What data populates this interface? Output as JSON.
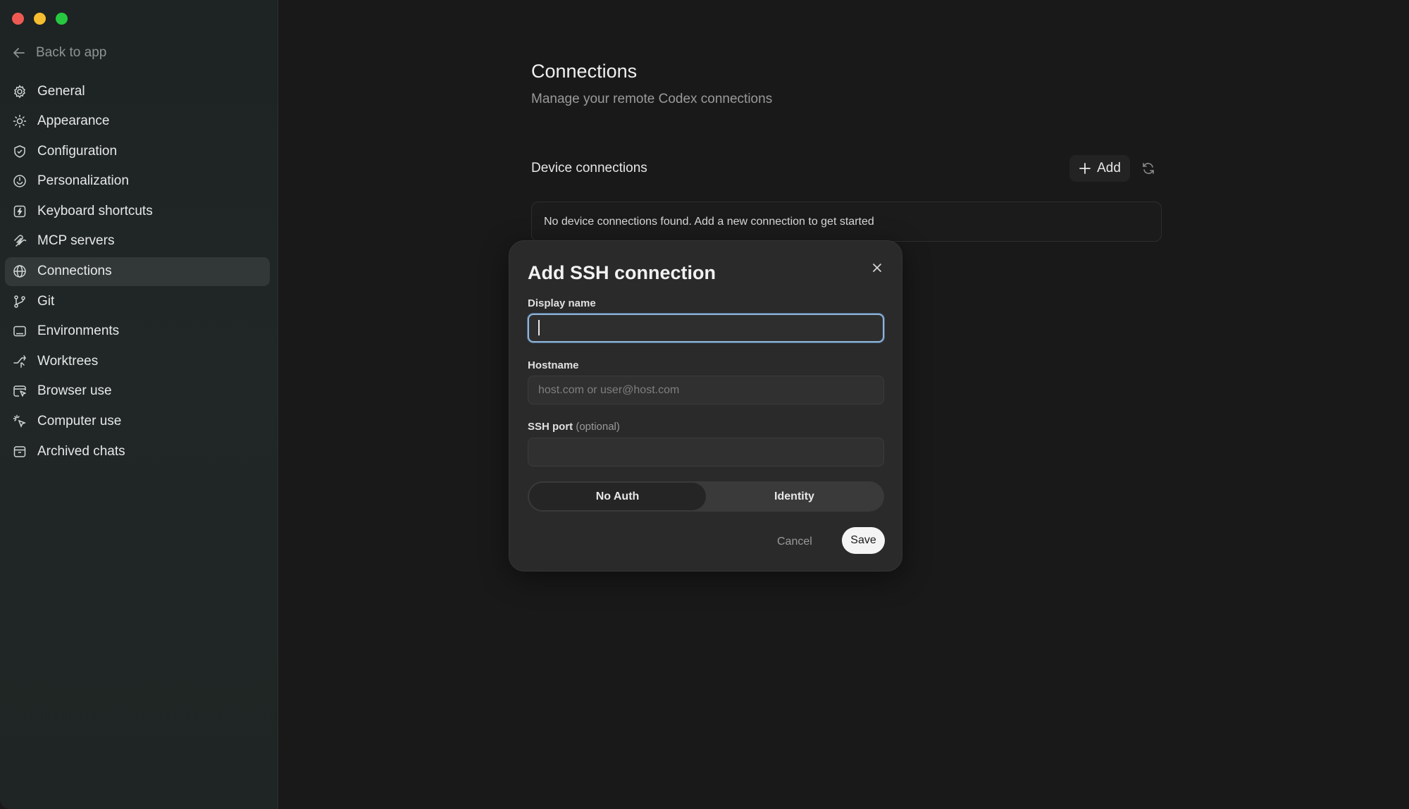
{
  "sidebar": {
    "back_label": "Back to app",
    "items": [
      {
        "label": "General",
        "icon": "gear-icon"
      },
      {
        "label": "Appearance",
        "icon": "sun-icon"
      },
      {
        "label": "Configuration",
        "icon": "shield-icon"
      },
      {
        "label": "Personalization",
        "icon": "smile-icon"
      },
      {
        "label": "Keyboard shortcuts",
        "icon": "keyboard-icon"
      },
      {
        "label": "MCP servers",
        "icon": "mcp-icon"
      },
      {
        "label": "Connections",
        "icon": "globe-icon",
        "active": true
      },
      {
        "label": "Git",
        "icon": "git-branch-icon"
      },
      {
        "label": "Environments",
        "icon": "monitor-icon"
      },
      {
        "label": "Worktrees",
        "icon": "worktree-icon"
      },
      {
        "label": "Browser use",
        "icon": "browser-icon"
      },
      {
        "label": "Computer use",
        "icon": "cursor-sparkle-icon"
      },
      {
        "label": "Archived chats",
        "icon": "archive-icon"
      }
    ]
  },
  "main": {
    "title": "Connections",
    "subtitle": "Manage your remote Codex connections",
    "section_title": "Device connections",
    "add_label": "Add",
    "empty_message": "No device connections found. Add a new connection to get started"
  },
  "modal": {
    "title": "Add SSH connection",
    "display_name_label": "Display name",
    "display_name_value": "",
    "hostname_label": "Hostname",
    "hostname_placeholder": "host.com or user@host.com",
    "port_label": "SSH port",
    "port_optional": "(optional)",
    "port_value": "",
    "auth_options": [
      "No Auth",
      "Identity"
    ],
    "auth_selected": "No Auth",
    "cancel_label": "Cancel",
    "save_label": "Save"
  },
  "colors": {
    "accent_focus": "#8fb3d6",
    "traffic_red": "#ee5a52",
    "traffic_yellow": "#f5bd2f",
    "traffic_green": "#27c840"
  }
}
